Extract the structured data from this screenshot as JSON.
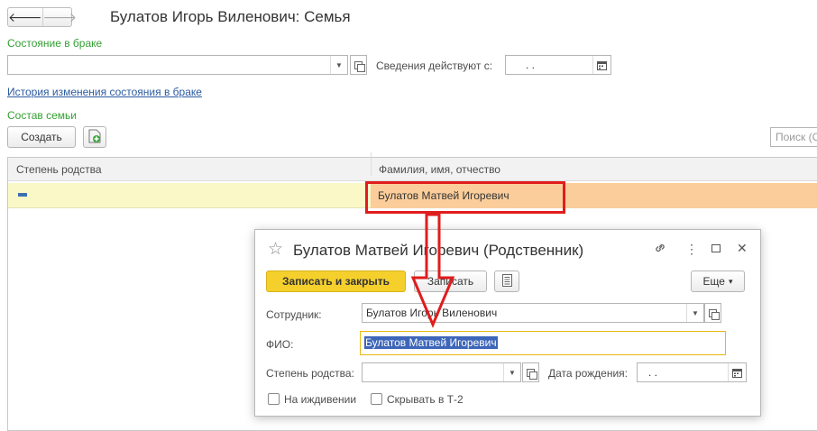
{
  "window": {
    "title": "Булатов Игорь Виленович: Семья",
    "back_glyph": "🡐",
    "forward_glyph": "🡒"
  },
  "marital": {
    "label": "Состояние в браке",
    "value": "",
    "effective_label": "Сведения действуют с:",
    "effective_value": ". .",
    "history_link": "История изменения состояния в браке"
  },
  "family": {
    "section_label": "Состав семьи",
    "create_button": "Создать",
    "search_placeholder": "Поиск (С",
    "columns": [
      "Степень родства",
      "Фамилия, имя, отчество"
    ],
    "rows": [
      {
        "relation": "",
        "name": "Булатов Матвей Игоревич"
      }
    ]
  },
  "modal": {
    "star_glyph": "☆",
    "title": "Булатов Матвей Игоревич (Родственник)",
    "link_glyph": "🔗",
    "menu_glyph": "⋮",
    "maximize_glyph": "☐",
    "close_glyph": "✕",
    "save_close_button": "Записать и закрыть",
    "save_button": "Записать",
    "more_button": "Еще",
    "more_glyph": "▾",
    "employee_label": "Сотрудник:",
    "employee_value": "Булатов Игорь Виленович",
    "fio_label": "ФИО:",
    "fio_value": "Булатов Матвей Игоревич",
    "relation_label": "Степень родства:",
    "relation_value": "",
    "birthdate_label": "Дата рождения:",
    "birthdate_value": ". .",
    "dependent_label": "На иждивении",
    "dependent_checked": false,
    "hide_t2_label": "Скрывать в Т-2",
    "hide_t2_checked": false
  },
  "colors": {
    "accent_green": "#33a033",
    "primary_button": "#f5cf2c",
    "selected_row": "#fbf8c8",
    "selected_cell": "#fbcd9a",
    "annotation_red": "#e01d1d"
  }
}
